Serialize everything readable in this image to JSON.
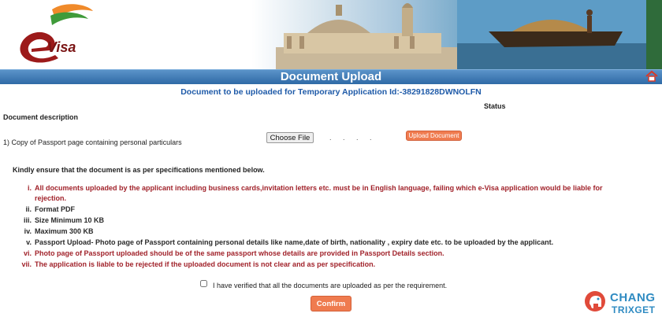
{
  "header": {
    "logo_text": "Visa",
    "title": "Document Upload"
  },
  "application": {
    "heading": "Document to be uploaded for Temporary Application Id:-38291828DWNOLFN"
  },
  "table": {
    "status_header": "Status",
    "description_header": "Document description",
    "rows": [
      {
        "description": "1) Copy of Passport page containing personal particulars",
        "choose_label": "Choose File",
        "file_dots": ". . . .",
        "upload_label": "Upload Document"
      }
    ]
  },
  "instructions": {
    "intro": "Kindly ensure that the document is as per specifications mentioned below.",
    "items": [
      {
        "num": "i.",
        "line1": "All documents uploaded by the applicant including business cards,invitation letters etc. must be in English language, failing which e-Visa application would be liable for",
        "line2": "rejection."
      },
      {
        "num": "ii.",
        "line1": "Format PDF"
      },
      {
        "num": "iii.",
        "line1": "Size Minimum 10 KB"
      },
      {
        "num": "iv.",
        "line1": "Maximum 300 KB"
      },
      {
        "num": "v.",
        "line1": "Passport Upload- Photo page of Passport containing personal details like name,date of birth, nationality , expiry date etc. to be uploaded by the applicant."
      },
      {
        "num": "vi.",
        "line1": "Photo page of Passport uploaded should be of the same passport whose details are provided in Passport Details section."
      },
      {
        "num": "vii.",
        "line1": "The application is liable to be rejected if the uploaded document is not clear and as per specification."
      }
    ]
  },
  "verify": {
    "label": "I have verified that all the documents are uploaded as per the requirement.",
    "checked": false
  },
  "confirm_label": "Confirm",
  "watermark": {
    "line1": "CHANG",
    "line2": "TRIXGET"
  },
  "colors": {
    "title_bar": "#2f6aa6",
    "heading_blue": "#1e5aa8",
    "rule_red": "#a1232b",
    "button_orange": "#ef7b4f"
  }
}
